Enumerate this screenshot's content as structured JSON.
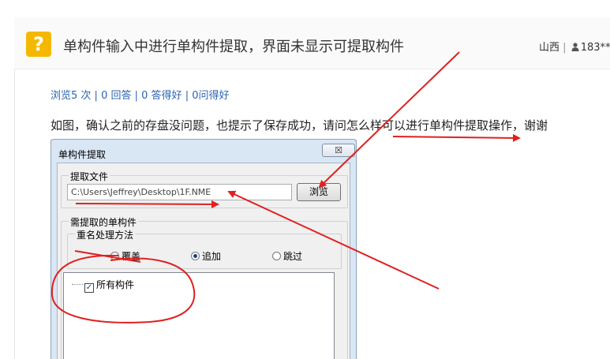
{
  "header": {
    "icon": "question-mark-icon",
    "icon_glyph": "?",
    "title": "单构件输入中进行单构件提取，界面未显示可提取构件",
    "region": "山西",
    "separator": "|",
    "user": "183**",
    "user_icon": "user-icon"
  },
  "stats": {
    "views": "浏览5 次",
    "answers": "0 回答",
    "good_answers": "0 答得好",
    "asks": "0问得好",
    "separator": "|"
  },
  "question_text": "如图，确认之前的存盘没问题，也提示了保存成功，请问怎么样可以进行单构件提取操作，谢谢",
  "dialog": {
    "title": "单构件提取",
    "close_glyph": "☒",
    "file_group_label": "提取文件",
    "file_path": "C:\\Users\\Jeffrey\\Desktop\\1F.NME",
    "browse_label": "浏览",
    "components_group_label": "需提取的单构件",
    "rename_group_label": "重名处理方法",
    "options": [
      "覆盖",
      "追加",
      "跳过"
    ],
    "selected_option": "追加",
    "tree_item_label": "所有构件",
    "tree_item_checked": true
  },
  "annotations": {
    "arrow_color": "#e02020",
    "circle_color": "#e02020"
  }
}
